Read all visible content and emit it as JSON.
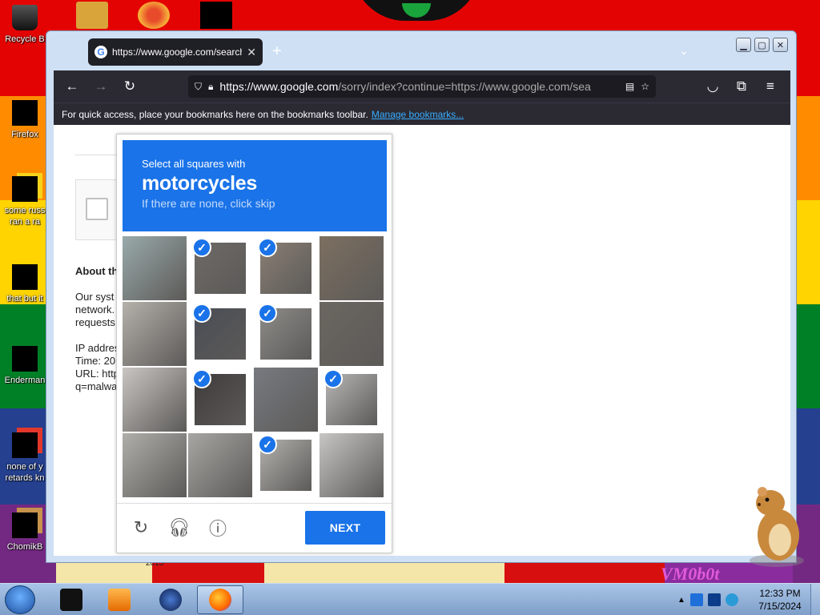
{
  "desktop": {
    "icons": [
      {
        "name": "recycle-bin",
        "label": "Recycle B"
      },
      {
        "name": "firefox",
        "label": "Firefox"
      },
      {
        "name": "some-russ",
        "label": "some russ\nran a ra"
      },
      {
        "name": "that-but",
        "label": "that but it"
      },
      {
        "name": "enderman",
        "label": "Enderman"
      },
      {
        "name": "none-of-y",
        "label": "none of y\nretards kn"
      },
      {
        "name": "chomik",
        "label": "ChomikB"
      }
    ],
    "watermark": "VM0b0t",
    "year_label": "2015"
  },
  "browser": {
    "tab_title": "https://www.google.com/search",
    "url_host": "https://www.google.com",
    "url_rest": "/sorry/index?continue=https://www.google.com/sea",
    "bookmarks_prompt": "For quick access, place your bookmarks here on the bookmarks toolbar.",
    "bookmarks_link": "Manage bookmarks..."
  },
  "page": {
    "about_heading": "About th",
    "para1_line1": "Our syst",
    "para1_line2": "network.",
    "para1_line3": "requests",
    "ip_label": "IP addres",
    "time_label": "Time: 20",
    "url_label": "URL: http",
    "url_cont": "q=malwa"
  },
  "captcha": {
    "instruction": "Select all squares with",
    "target": "motorcycles",
    "hint": "If there are none, click skip",
    "selected": [
      false,
      true,
      true,
      false,
      false,
      true,
      true,
      false,
      false,
      true,
      false,
      true,
      false,
      false,
      true,
      false
    ],
    "next_label": "NEXT"
  },
  "taskbar": {
    "time": "12:33 PM",
    "date": "7/15/2024"
  },
  "colors": {
    "captcha_blue": "#1a73e8",
    "browser_dark": "#2b2a33",
    "link_blue": "#37adff"
  }
}
